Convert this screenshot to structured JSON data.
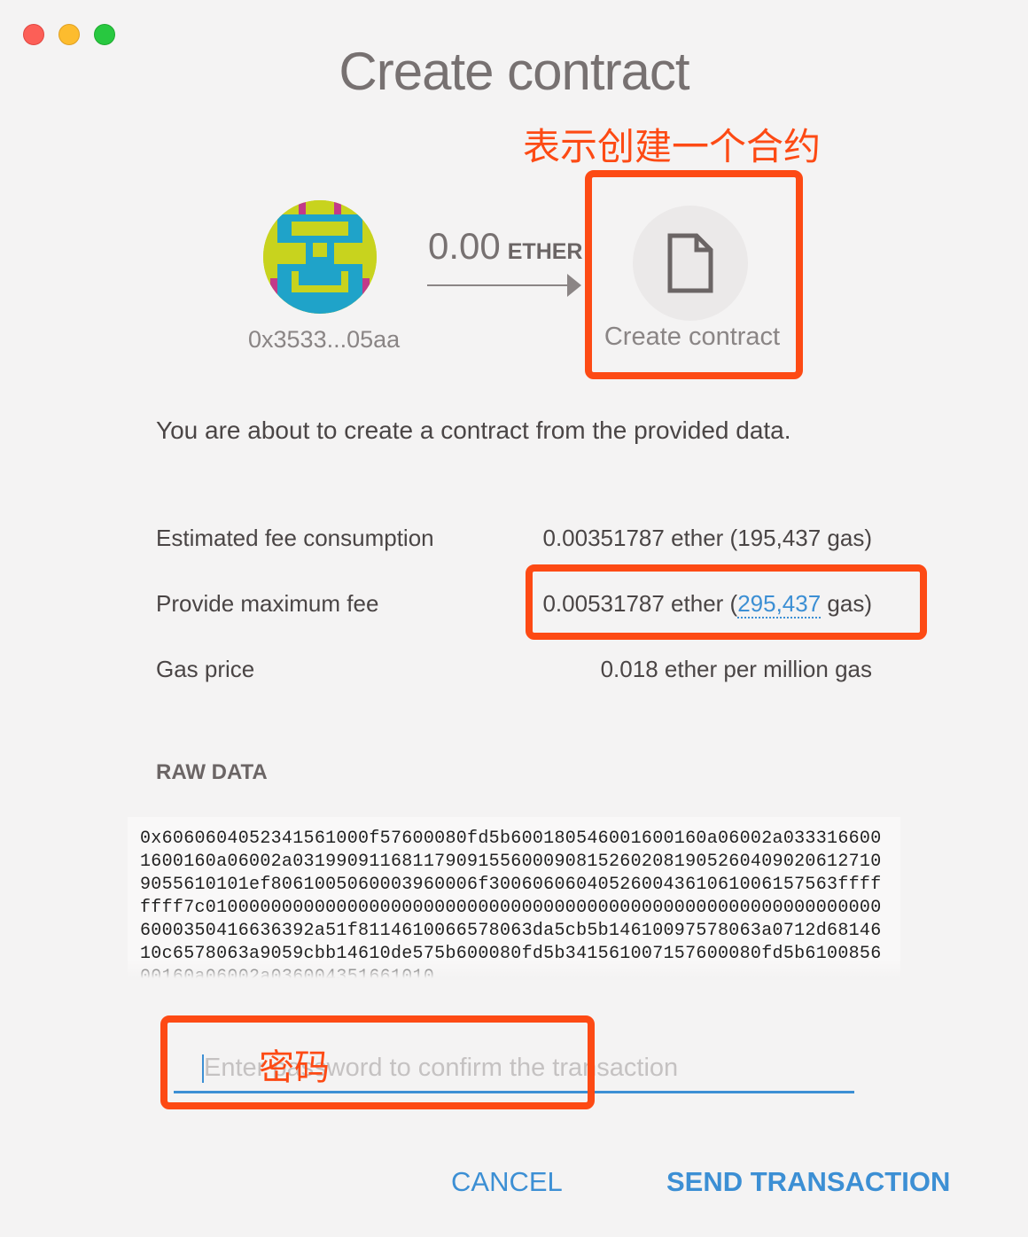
{
  "window": {
    "title": "Create contract"
  },
  "annotations": {
    "create_contract_note": "表示创建一个合约",
    "password_note": "密码"
  },
  "from": {
    "address": "0x3533...05aa"
  },
  "amount": {
    "value": "0.00",
    "unit": "ETHER"
  },
  "to": {
    "label": "Create contract",
    "icon": "document-icon"
  },
  "description": "You are about to create a contract from the provided data.",
  "fees": {
    "estimated": {
      "label": "Estimated fee consumption",
      "value": "0.00351787 ether (195,437 gas)"
    },
    "maximum": {
      "label": "Provide maximum fee",
      "value_prefix": "0.00531787 ether (",
      "gas": "295,437",
      "value_suffix": " gas)"
    },
    "gas_price": {
      "label": "Gas price",
      "value": "0.018 ether per million gas"
    }
  },
  "raw_data": {
    "heading": "RAW DATA",
    "text": "0x6060604052341561000f57600080fd5b600180546001600160a06002a0333166001600160a06002a0319909116811790915560009081526020819052604090206127109055610101ef8061005060003960006f30060606040526004361061006157563ffffffff7c010000000000000000000000000000000000000000000000000000000000006000350416636392a51f8114610066578063da5cb5b14610097578063a0712d6814610c6578063a9059cbb14610de575b600080fd5b341561007157600080fd5b610085600160a06002a036004351661010"
  },
  "password": {
    "placeholder": "Enter password to confirm the transaction",
    "value": ""
  },
  "actions": {
    "cancel": "CANCEL",
    "send": "SEND TRANSACTION"
  },
  "colors": {
    "accent": "#3c8fd4",
    "annotation": "#fd4a14",
    "background": "#f4f3f3"
  }
}
